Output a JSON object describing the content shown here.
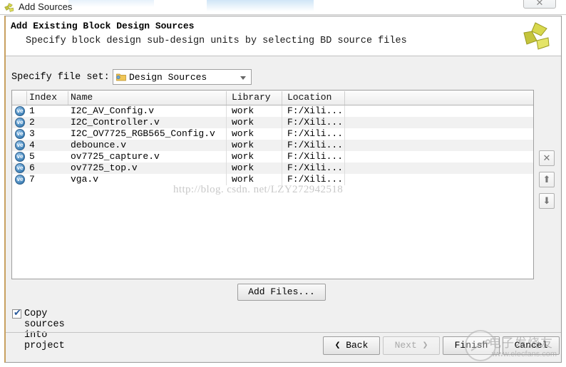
{
  "window": {
    "title": "Add Sources",
    "title_icon": "vivado-logo-icon",
    "close_label": "✕"
  },
  "banner": {
    "title": "Add Existing Block Design Sources",
    "subtitle": "Specify block design sub-design units by selecting BD source files",
    "logo_icon": "xilinx-pinwheel-logo-icon"
  },
  "fileset": {
    "label": "Specify file set:",
    "value": "Design Sources",
    "folder_icon": "folder-icon",
    "dropdown_icon": "chevron-down-icon",
    "options": [
      "Design Sources"
    ]
  },
  "table": {
    "columns": [
      "Index",
      "Name",
      "Library",
      "Location"
    ],
    "rows": [
      {
        "icon": "verilog-file-icon",
        "index": "1",
        "name": "I2C_AV_Config.v",
        "library": "work",
        "location": "F:/Xili..."
      },
      {
        "icon": "verilog-file-icon",
        "index": "2",
        "name": "I2C_Controller.v",
        "library": "work",
        "location": "F:/Xili..."
      },
      {
        "icon": "verilog-file-icon",
        "index": "3",
        "name": "I2C_OV7725_RGB565_Config.v",
        "library": "work",
        "location": "F:/Xili..."
      },
      {
        "icon": "verilog-file-icon",
        "index": "4",
        "name": "debounce.v",
        "library": "work",
        "location": "F:/Xili..."
      },
      {
        "icon": "verilog-file-icon",
        "index": "5",
        "name": "ov7725_capture.v",
        "library": "work",
        "location": "F:/Xili..."
      },
      {
        "icon": "verilog-file-icon",
        "index": "6",
        "name": "ov7725_top.v",
        "library": "work",
        "location": "F:/Xili..."
      },
      {
        "icon": "verilog-file-icon",
        "index": "7",
        "name": "vga.v",
        "library": "work",
        "location": "F:/Xili..."
      }
    ]
  },
  "side_tools": {
    "remove_label": "✕",
    "remove_icon": "remove-x-icon",
    "move_up_label": "⬆",
    "move_up_icon": "arrow-up-icon",
    "move_down_label": "⬇",
    "move_down_icon": "arrow-down-icon"
  },
  "actions": {
    "add_files_label": "Add Files...",
    "copy_sources_label": "Copy sources into project",
    "copy_sources_checked": true,
    "copy_sources_tick": "✔"
  },
  "footer": {
    "back_label": "❮ Back",
    "next_label": "Next ❯",
    "next_disabled": true,
    "finish_label": "Finish",
    "cancel_label": "Cancel"
  },
  "watermarks": {
    "csdn": "http://blog. csdn. net/LZY272942518",
    "elecfans_cn": "电子发烧友",
    "elecfans_url": "www.elecfans.com"
  },
  "colors": {
    "dialog_bg": "#f0f0f0",
    "panel_bg": "#ffffff",
    "row_alt": "#f1f1f1",
    "border": "#9a9a9a",
    "accent_left_border": "#c8a060",
    "logo_yellow": "#cfcf43"
  }
}
